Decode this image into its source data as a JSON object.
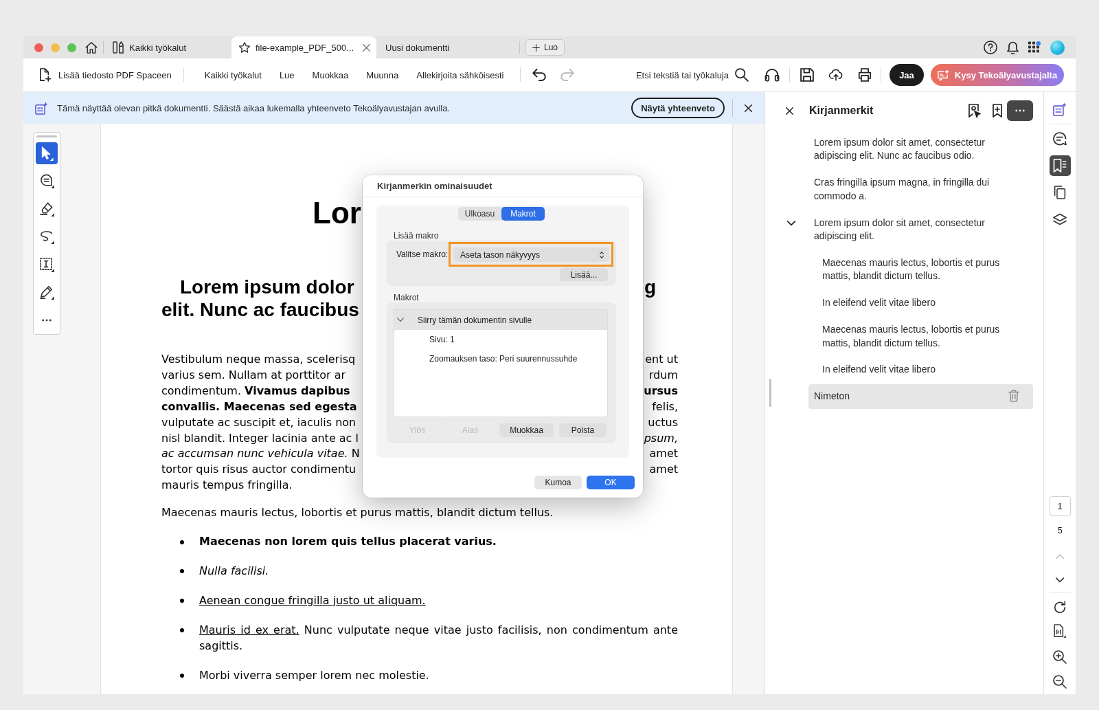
{
  "browser_tabs": [
    {
      "kind": "tools",
      "label": "Kaikki työkalut",
      "selected": false
    },
    {
      "kind": "file",
      "label": "file-example_PDF_500...",
      "selected": true
    },
    {
      "kind": "plain",
      "label": "Uusi dokumentti",
      "selected": false
    }
  ],
  "new_button": "Luo",
  "toolbar": {
    "add_to_space": "Lisää tiedosto PDF Spaceen",
    "menu": [
      "Kaikki työkalut",
      "Lue",
      "Muokkaa",
      "Muunna",
      "Allekirjoita sähköisesti"
    ],
    "history": [
      {
        "kind": "undo",
        "disabled": false
      },
      {
        "kind": "redo",
        "disabled": true
      }
    ],
    "search": {
      "placeholder": "Etsi tekstiä tai työkaluja"
    },
    "share_button": "Jaa",
    "ai_button": "Kysy Tekoälyavustajalta"
  },
  "banner": {
    "text": "Tämä näyttää olevan pitkä dokumentti. Säästä aikaa lukemalla yhteenveto Tekoälyavustajan avulla.",
    "button": "Näytä yhteenveto"
  },
  "tools": [
    {
      "kind": "select",
      "selected": true
    },
    {
      "kind": "comment",
      "selected": false
    },
    {
      "kind": "highlight",
      "selected": false
    },
    {
      "kind": "draw",
      "selected": false
    },
    {
      "kind": "text",
      "selected": false
    },
    {
      "kind": "sign",
      "selected": false
    },
    {
      "kind": "more",
      "selected": false
    }
  ],
  "document": {
    "title": "Lor",
    "heading": [
      {
        "left": "Lorem ipsum dolor",
        "right": "g"
      },
      {
        "left": "elit. Nunc ac faucibus"
      }
    ],
    "lines": [
      {
        "left": {
          "text": "Vestibulum neque massa, scelerisq",
          "kind": "plain"
        },
        "right": {
          "text": "ent ut",
          "kind": "plain"
        }
      },
      {
        "left": {
          "text": "varius sem. Nullam at porttitor ar",
          "kind": "plain"
        },
        "right": {
          "text": "rdum",
          "kind": "plain"
        }
      },
      {
        "left": {
          "text": "condimentum. **Vivamus dapibus**",
          "kind": "plain"
        },
        "right": {
          "text": "ursus",
          "kind": "bold"
        }
      },
      {
        "left": {
          "text": "convallis. Maecenas sed egesta",
          "kind": "bold"
        },
        "right": {
          "text": "felis,",
          "kind": "plain"
        }
      },
      {
        "left": {
          "text": "vulputate ac suscipit et, iaculis non",
          "kind": "plain"
        },
        "right": {
          "text": "uctus",
          "kind": "plain"
        }
      },
      {
        "left": {
          "text": "nisl blandit. Integer lacinia ante ac l",
          "kind": "plain"
        },
        "right": {
          "text": "psum,",
          "kind": "italic"
        }
      },
      {
        "left": {
          "text": "*ac accumsan nunc vehicula vitae.* N",
          "kind": "plain"
        },
        "right": {
          "text": "amet",
          "kind": "plain"
        }
      },
      {
        "left": {
          "text": "tortor quis risus auctor condimentu",
          "kind": "plain"
        },
        "right": {
          "text": "amet",
          "kind": "plain"
        }
      },
      {
        "left": {
          "text": "mauris tempus fringilla.",
          "kind": "plain"
        }
      }
    ],
    "paragraph": "Maecenas mauris lectus, lobortis et purus mattis, blandit dictum tellus.",
    "bullets": [
      {
        "kind": "bold",
        "text": "Maecenas non lorem quis tellus placerat varius."
      },
      {
        "kind": "italic",
        "text": "Nulla facilisi."
      },
      {
        "kind": "link",
        "text": "Aenean congue fringilla justo ut aliquam."
      },
      {
        "kind": "link_lead",
        "link": "Mauris id ex erat.",
        "text": "Nunc vulputate neque vitae justo facilisis, non condimentum ante sagittis."
      },
      {
        "kind": "plain",
        "text": "Morbi viverra semper lorem nec molestie."
      }
    ]
  },
  "bookmarks": {
    "title": "Kirjanmerkit",
    "items": [
      {
        "label": "Lorem ipsum dolor sit amet, consectetur adipiscing elit. Nunc ac faucibus odio.",
        "selected": false
      },
      {
        "label": "Cras fringilla ipsum magna, in fringilla dui commodo a.",
        "selected": false
      },
      {
        "label": "Lorem ipsum dolor sit amet, consectetur adipiscing elit.",
        "selected": false,
        "expanded": true,
        "children": [
          {
            "label": "Maecenas mauris lectus, lobortis et purus mattis, blandit dictum tellus.",
            "selected": false
          },
          {
            "label": "In eleifend velit vitae libero",
            "selected": false
          },
          {
            "label": "Maecenas mauris lectus, lobortis et purus mattis, blandit dictum tellus.",
            "selected": false
          },
          {
            "label": "In eleifend velit vitae libero",
            "selected": false
          }
        ]
      },
      {
        "label": "Nimeton",
        "selected": true
      }
    ]
  },
  "rail": {
    "tools": [
      {
        "kind": "ai",
        "selected": false
      },
      {
        "kind": "comments",
        "selected": false
      },
      {
        "kind": "bookmarks",
        "selected": true
      },
      {
        "kind": "pages",
        "selected": false
      },
      {
        "kind": "layers",
        "selected": false
      }
    ],
    "page": {
      "value": "1",
      "total": "5"
    },
    "nav": [
      {
        "kind": "prev",
        "disabled": true
      },
      {
        "kind": "next",
        "disabled": false
      }
    ]
  },
  "dialog": {
    "title": "Kirjanmerkin ominaisuudet",
    "tabs": [
      {
        "label": "Ulkoasu",
        "selected": false
      },
      {
        "label": "Makrot",
        "selected": true
      }
    ],
    "add_macro": {
      "heading": "Lisää makro",
      "label": "Valitse makro:",
      "value": "Aseta tason näkyvyys",
      "highlighted": true,
      "button": "Lisää..."
    },
    "macros": {
      "heading": "Makrot",
      "items": [
        {
          "label": "Siirry tämän dokumentin sivulle",
          "selected": true,
          "expanded": true,
          "children": [
            {
              "label": "Sivu: 1",
              "selected": false
            },
            {
              "label": "Zoomauksen taso: Peri suurennussuhde",
              "selected": false
            }
          ]
        }
      ],
      "buttons": [
        {
          "label": "Ylös",
          "disabled": true
        },
        {
          "label": "Alas",
          "disabled": true
        },
        {
          "label": "Muokkaa",
          "disabled": false
        },
        {
          "label": "Poista",
          "disabled": false
        }
      ]
    },
    "footer": [
      {
        "label": "Kumoa",
        "kind": "secondary"
      },
      {
        "label": "OK",
        "kind": "primary"
      }
    ]
  }
}
